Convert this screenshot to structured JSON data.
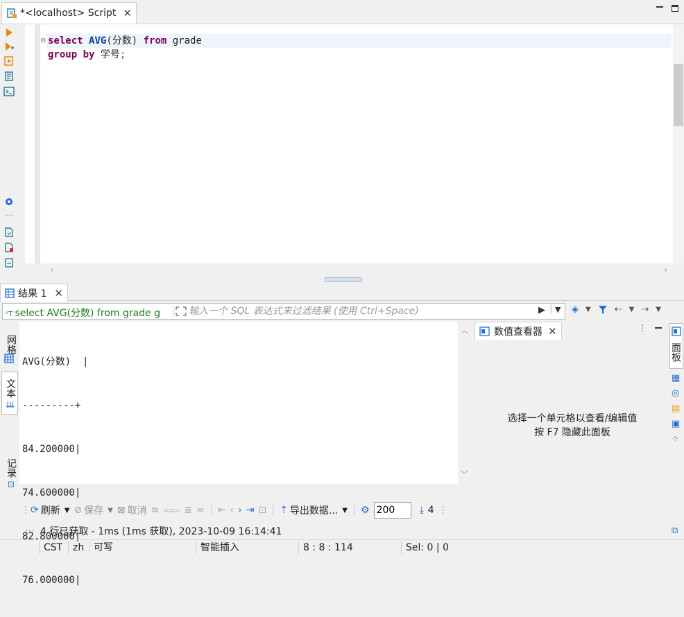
{
  "editor_tab": {
    "title": "*<localhost> Script",
    "close": "✕"
  },
  "editor": {
    "lines": [
      [
        {
          "t": "select",
          "c": "kw"
        },
        {
          "t": " ",
          "c": "plain"
        },
        {
          "t": "AVG",
          "c": "fn"
        },
        {
          "t": "(分数) ",
          "c": "plain"
        },
        {
          "t": "from",
          "c": "kw"
        },
        {
          "t": " grade",
          "c": "plain"
        }
      ],
      [
        {
          "t": "group",
          "c": "kw"
        },
        {
          "t": " ",
          "c": "plain"
        },
        {
          "t": "by",
          "c": "kw"
        },
        {
          "t": " 学号",
          "c": "plain"
        },
        {
          "t": ";",
          "c": "semi"
        }
      ]
    ]
  },
  "results_tab": {
    "label": "结果 1",
    "close": "✕"
  },
  "filter": {
    "query": "select AVG(分数) from grade g",
    "placeholder": "输入一个 SQL 表达式来过滤结果 (使用 Ctrl+Space)"
  },
  "side_tabs": {
    "grid": "网格",
    "text": "文本",
    "record": "记录"
  },
  "text_output": {
    "lines": [
      "AVG(分数)  |",
      "---------+",
      "84.200000|",
      "74.600000|",
      "82.800000|",
      "76.000000|"
    ]
  },
  "viewer": {
    "tab_label": "数值查看器",
    "close": "✕",
    "hint_line1": "选择一个单元格以查看/编辑值",
    "hint_line2": "按 F7 隐藏此面板",
    "rail_label": "面板"
  },
  "toolbar": {
    "refresh": "刷新",
    "save": "保存",
    "cancel": "取消",
    "export": "导出数据...",
    "fetch_size": "200",
    "row_count": "4"
  },
  "status_line": "4 行已获取 - 1ms (1ms 获取), 2023-10-09 16:14:41",
  "status_bar": {
    "timezone": "CST",
    "locale": "zh",
    "mode": "可写",
    "insert": "智能插入",
    "cursor": "8 : 8 : 114",
    "selection": "Sel: 0 | 0"
  },
  "colors": {
    "keyword": "#7f0055",
    "function": "#0b3da6",
    "accent": "#1e6fd9",
    "query": "#1a7f1a"
  },
  "icons": [
    "script-icon",
    "run-statement-icon",
    "run-script-icon",
    "explain-icon",
    "console-icon",
    "settings-icon",
    "refresh-icon",
    "filter-icon",
    "export-icon",
    "panel-icon"
  ]
}
